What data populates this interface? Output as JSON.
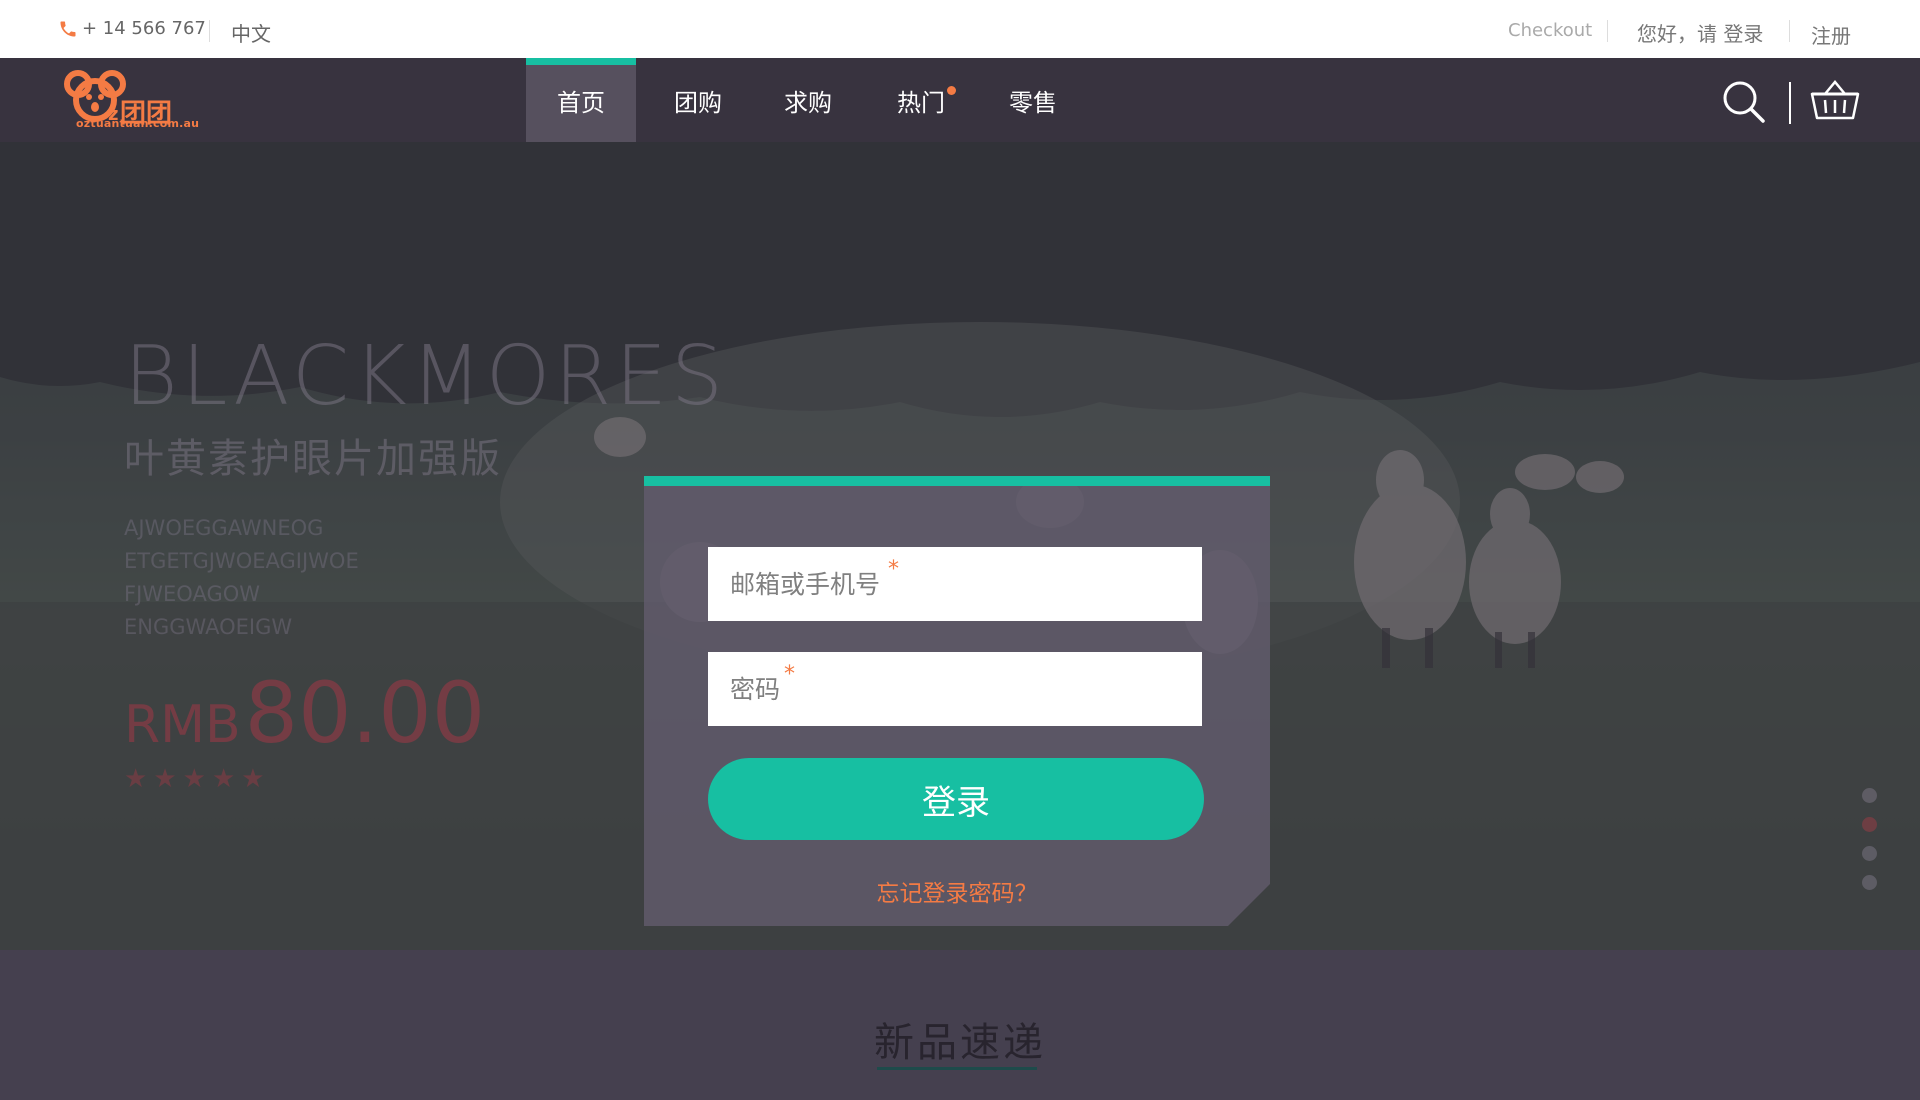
{
  "topbar": {
    "phone": "+ 14 566 767",
    "language": "中文",
    "checkout": "Checkout",
    "greeting": "您好，请 登录",
    "register": "注册"
  },
  "logo": {
    "text": "团团",
    "tagline": "oztuantuan.com.au",
    "color": "#f47b44"
  },
  "nav": {
    "items": [
      {
        "label": "首页",
        "active": true
      },
      {
        "label": "团购"
      },
      {
        "label": "求购"
      },
      {
        "label": "热门",
        "badge": "dot"
      },
      {
        "label": "零售"
      }
    ],
    "icons": [
      "search-icon",
      "basket-icon"
    ]
  },
  "hero": {
    "brand": "BLACKMORES",
    "subtitle": "叶黄素护眼片加强版",
    "lines": [
      "AJWOEGGAWNEOG",
      "ETGETGJWOEAGIJWOE",
      "FJWEOAGOW",
      "ENGGWAOEIGW"
    ],
    "currency": "RMB",
    "price": "80.00",
    "rating": 5,
    "slides": 4,
    "active_slide": 2
  },
  "login": {
    "email_placeholder": "邮箱或手机号",
    "password_placeholder": "密码",
    "required_mark": "*",
    "submit": "登录",
    "forgot": "忘记登录密码？"
  },
  "section": {
    "title": "新品速递"
  },
  "colors": {
    "accent": "#17bfa2",
    "orange": "#f47b44",
    "nav_bg": "#38333f"
  }
}
